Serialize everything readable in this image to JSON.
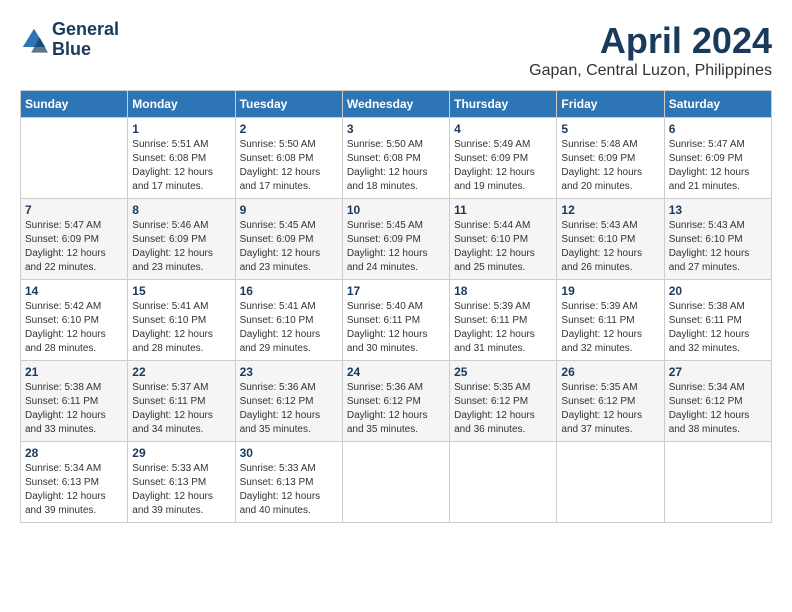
{
  "logo": {
    "line1": "General",
    "line2": "Blue"
  },
  "title": "April 2024",
  "location": "Gapan, Central Luzon, Philippines",
  "days_header": [
    "Sunday",
    "Monday",
    "Tuesday",
    "Wednesday",
    "Thursday",
    "Friday",
    "Saturday"
  ],
  "weeks": [
    [
      {
        "num": "",
        "info": ""
      },
      {
        "num": "1",
        "info": "Sunrise: 5:51 AM\nSunset: 6:08 PM\nDaylight: 12 hours\nand 17 minutes."
      },
      {
        "num": "2",
        "info": "Sunrise: 5:50 AM\nSunset: 6:08 PM\nDaylight: 12 hours\nand 17 minutes."
      },
      {
        "num": "3",
        "info": "Sunrise: 5:50 AM\nSunset: 6:08 PM\nDaylight: 12 hours\nand 18 minutes."
      },
      {
        "num": "4",
        "info": "Sunrise: 5:49 AM\nSunset: 6:09 PM\nDaylight: 12 hours\nand 19 minutes."
      },
      {
        "num": "5",
        "info": "Sunrise: 5:48 AM\nSunset: 6:09 PM\nDaylight: 12 hours\nand 20 minutes."
      },
      {
        "num": "6",
        "info": "Sunrise: 5:47 AM\nSunset: 6:09 PM\nDaylight: 12 hours\nand 21 minutes."
      }
    ],
    [
      {
        "num": "7",
        "info": "Sunrise: 5:47 AM\nSunset: 6:09 PM\nDaylight: 12 hours\nand 22 minutes."
      },
      {
        "num": "8",
        "info": "Sunrise: 5:46 AM\nSunset: 6:09 PM\nDaylight: 12 hours\nand 23 minutes."
      },
      {
        "num": "9",
        "info": "Sunrise: 5:45 AM\nSunset: 6:09 PM\nDaylight: 12 hours\nand 23 minutes."
      },
      {
        "num": "10",
        "info": "Sunrise: 5:45 AM\nSunset: 6:09 PM\nDaylight: 12 hours\nand 24 minutes."
      },
      {
        "num": "11",
        "info": "Sunrise: 5:44 AM\nSunset: 6:10 PM\nDaylight: 12 hours\nand 25 minutes."
      },
      {
        "num": "12",
        "info": "Sunrise: 5:43 AM\nSunset: 6:10 PM\nDaylight: 12 hours\nand 26 minutes."
      },
      {
        "num": "13",
        "info": "Sunrise: 5:43 AM\nSunset: 6:10 PM\nDaylight: 12 hours\nand 27 minutes."
      }
    ],
    [
      {
        "num": "14",
        "info": "Sunrise: 5:42 AM\nSunset: 6:10 PM\nDaylight: 12 hours\nand 28 minutes."
      },
      {
        "num": "15",
        "info": "Sunrise: 5:41 AM\nSunset: 6:10 PM\nDaylight: 12 hours\nand 28 minutes."
      },
      {
        "num": "16",
        "info": "Sunrise: 5:41 AM\nSunset: 6:10 PM\nDaylight: 12 hours\nand 29 minutes."
      },
      {
        "num": "17",
        "info": "Sunrise: 5:40 AM\nSunset: 6:11 PM\nDaylight: 12 hours\nand 30 minutes."
      },
      {
        "num": "18",
        "info": "Sunrise: 5:39 AM\nSunset: 6:11 PM\nDaylight: 12 hours\nand 31 minutes."
      },
      {
        "num": "19",
        "info": "Sunrise: 5:39 AM\nSunset: 6:11 PM\nDaylight: 12 hours\nand 32 minutes."
      },
      {
        "num": "20",
        "info": "Sunrise: 5:38 AM\nSunset: 6:11 PM\nDaylight: 12 hours\nand 32 minutes."
      }
    ],
    [
      {
        "num": "21",
        "info": "Sunrise: 5:38 AM\nSunset: 6:11 PM\nDaylight: 12 hours\nand 33 minutes."
      },
      {
        "num": "22",
        "info": "Sunrise: 5:37 AM\nSunset: 6:11 PM\nDaylight: 12 hours\nand 34 minutes."
      },
      {
        "num": "23",
        "info": "Sunrise: 5:36 AM\nSunset: 6:12 PM\nDaylight: 12 hours\nand 35 minutes."
      },
      {
        "num": "24",
        "info": "Sunrise: 5:36 AM\nSunset: 6:12 PM\nDaylight: 12 hours\nand 35 minutes."
      },
      {
        "num": "25",
        "info": "Sunrise: 5:35 AM\nSunset: 6:12 PM\nDaylight: 12 hours\nand 36 minutes."
      },
      {
        "num": "26",
        "info": "Sunrise: 5:35 AM\nSunset: 6:12 PM\nDaylight: 12 hours\nand 37 minutes."
      },
      {
        "num": "27",
        "info": "Sunrise: 5:34 AM\nSunset: 6:12 PM\nDaylight: 12 hours\nand 38 minutes."
      }
    ],
    [
      {
        "num": "28",
        "info": "Sunrise: 5:34 AM\nSunset: 6:13 PM\nDaylight: 12 hours\nand 39 minutes."
      },
      {
        "num": "29",
        "info": "Sunrise: 5:33 AM\nSunset: 6:13 PM\nDaylight: 12 hours\nand 39 minutes."
      },
      {
        "num": "30",
        "info": "Sunrise: 5:33 AM\nSunset: 6:13 PM\nDaylight: 12 hours\nand 40 minutes."
      },
      {
        "num": "",
        "info": ""
      },
      {
        "num": "",
        "info": ""
      },
      {
        "num": "",
        "info": ""
      },
      {
        "num": "",
        "info": ""
      }
    ]
  ]
}
